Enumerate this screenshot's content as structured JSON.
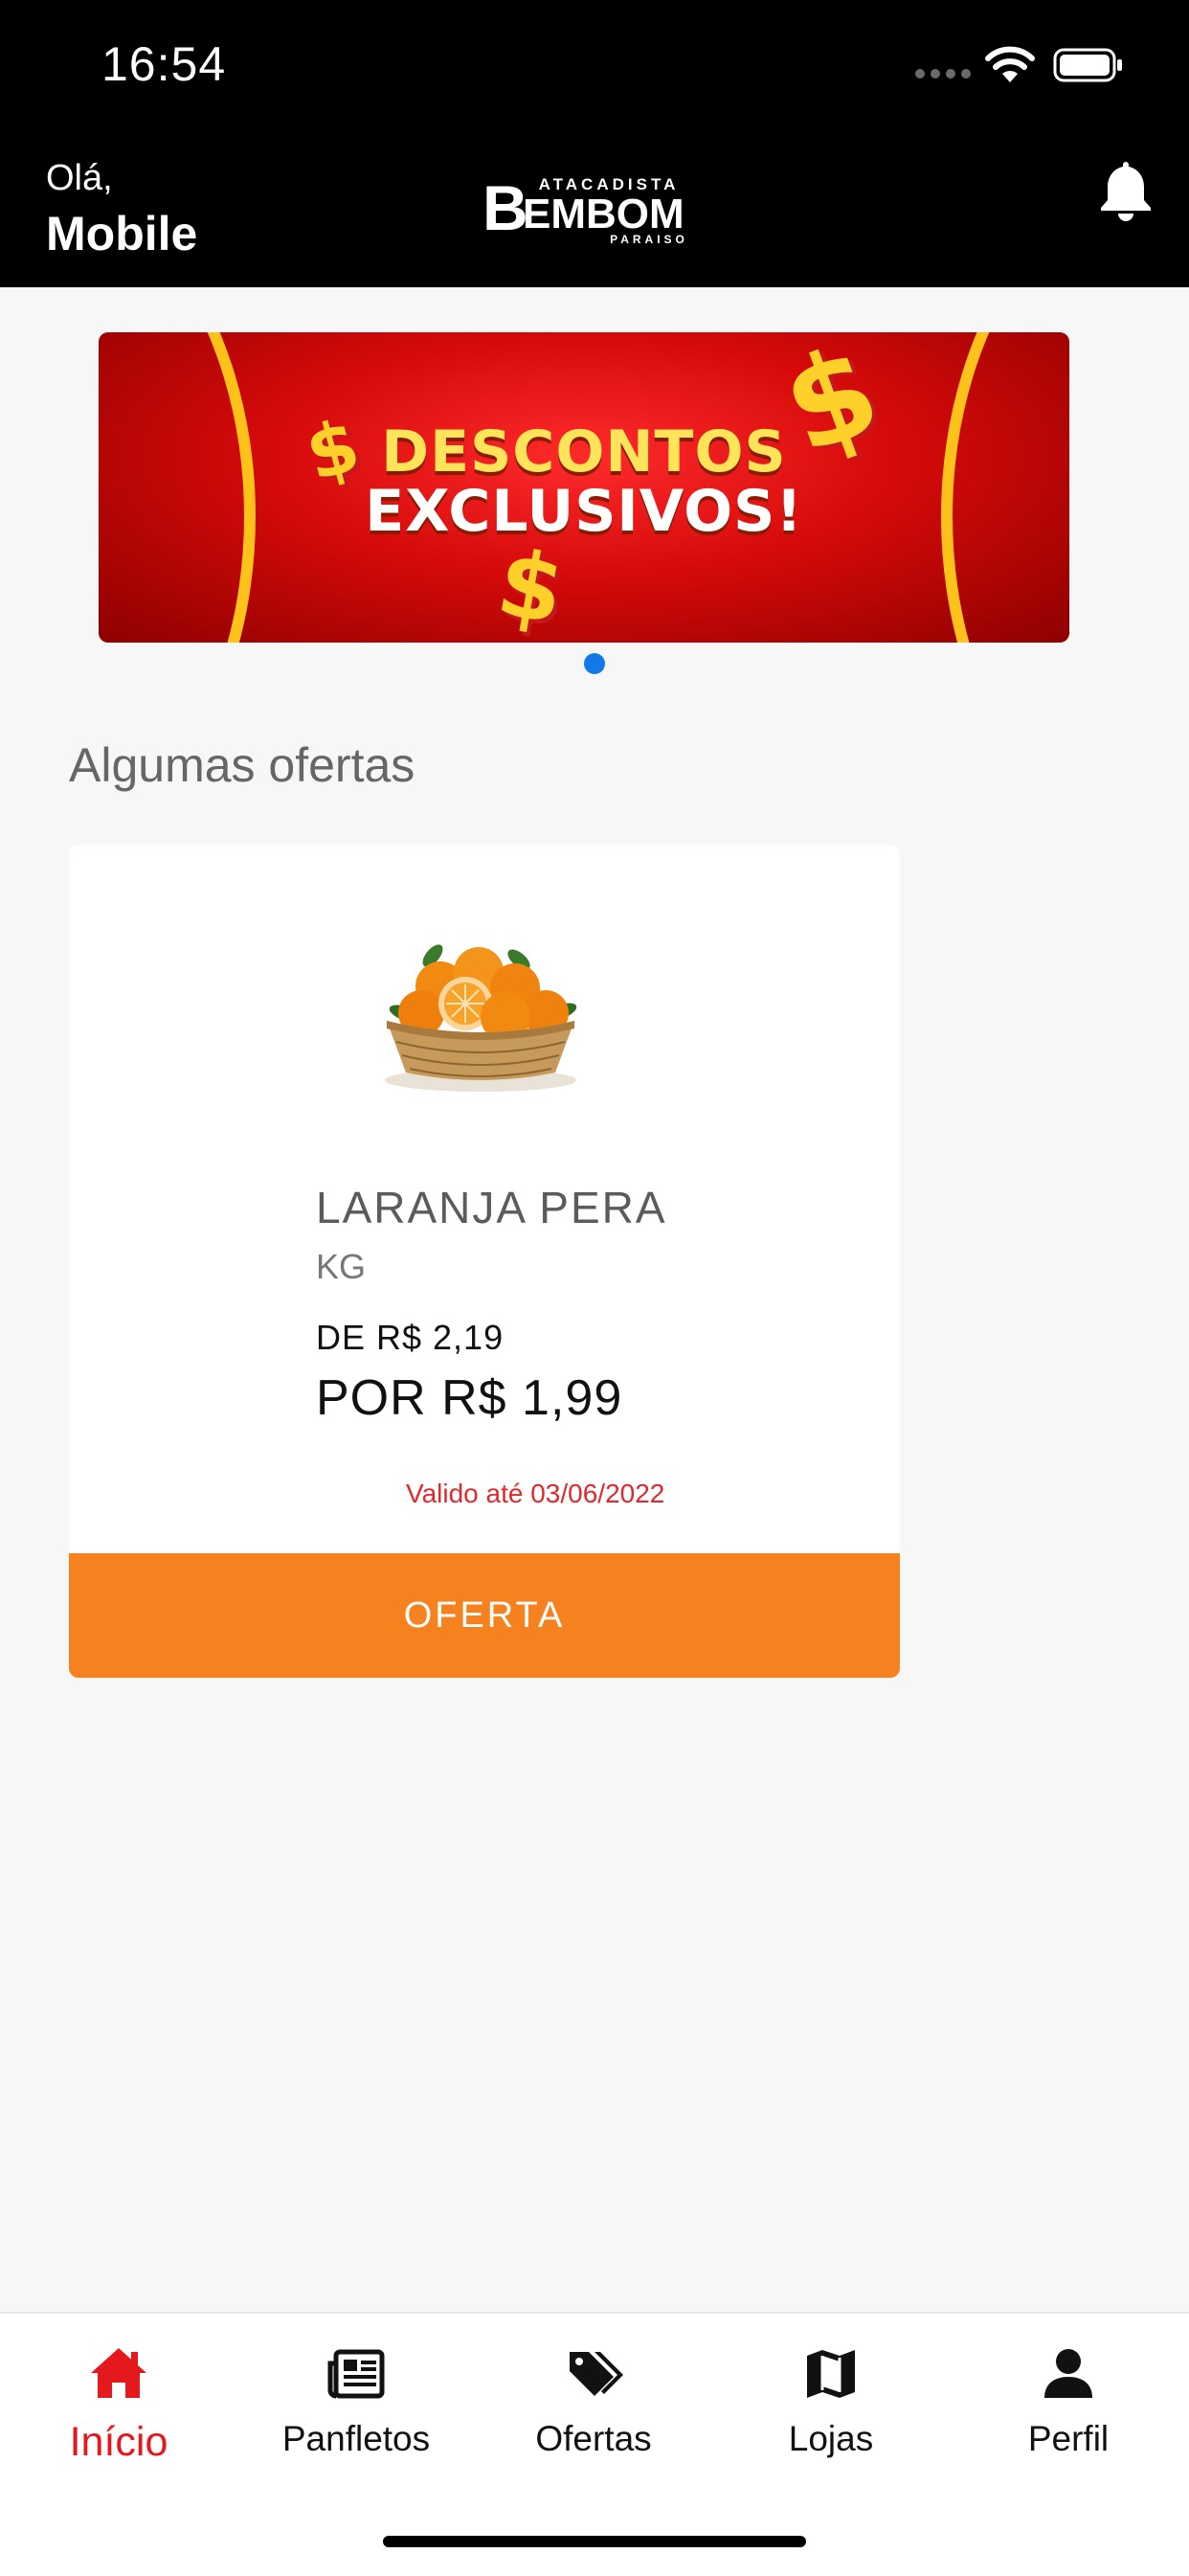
{
  "status_bar": {
    "time": "16:54"
  },
  "header": {
    "greeting": "Olá,",
    "user_name": "Mobile",
    "logo": {
      "line1": "ATACADISTA",
      "line2": "BEMBOM",
      "line3": "PARAISO"
    }
  },
  "banner": {
    "line1": "DESCONTOS",
    "line2": "EXCLUSIVOS!"
  },
  "section": {
    "title": "Algumas ofertas"
  },
  "offer": {
    "name": "LARANJA PERA",
    "unit": "KG",
    "old_price": "DE R$ 2,19",
    "new_price": "POR R$ 1,99",
    "valid_until": "Valido até 03/06/2022",
    "button_label": "OFERTA"
  },
  "tabs": [
    {
      "label": "Início",
      "icon": "home-icon",
      "active": true
    },
    {
      "label": "Panfletos",
      "icon": "newspaper-icon",
      "active": false
    },
    {
      "label": "Ofertas",
      "icon": "tags-icon",
      "active": false
    },
    {
      "label": "Lojas",
      "icon": "map-icon",
      "active": false
    },
    {
      "label": "Perfil",
      "icon": "user-icon",
      "active": false
    }
  ],
  "colors": {
    "header_bg": "#000000",
    "accent_red": "#e3191e",
    "offer_button": "#f5821f",
    "pager_dot": "#1379e8",
    "valid_text": "#e0292e"
  }
}
